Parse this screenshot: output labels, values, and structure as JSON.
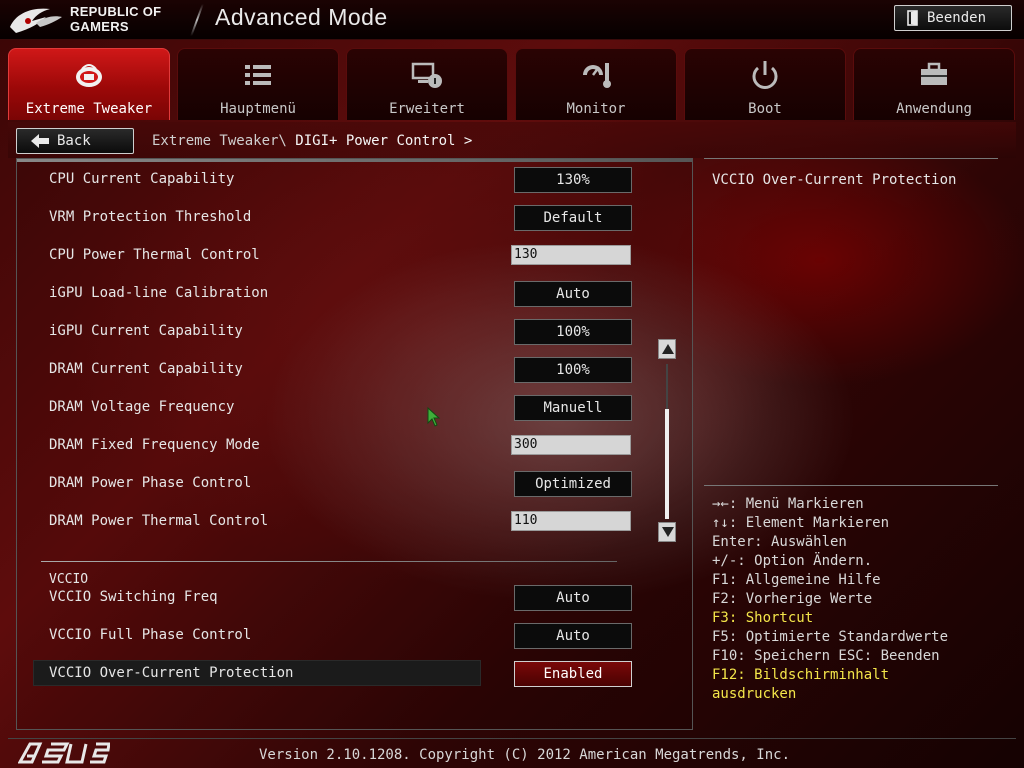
{
  "header": {
    "brand_line1": "REPUBLIC OF",
    "brand_line2": "GAMERS",
    "title": "Advanced Mode",
    "exit_label": "Beenden"
  },
  "tabs": [
    {
      "label": "Extreme Tweaker",
      "icon": "tweaker-icon",
      "active": true
    },
    {
      "label": "Hauptmenü",
      "icon": "list-icon",
      "active": false
    },
    {
      "label": "Erweitert",
      "icon": "advanced-icon",
      "active": false
    },
    {
      "label": "Monitor",
      "icon": "monitor-icon",
      "active": false
    },
    {
      "label": "Boot",
      "icon": "power-icon",
      "active": false
    },
    {
      "label": "Anwendung",
      "icon": "toolbox-icon",
      "active": false
    }
  ],
  "nav": {
    "back_label": "Back",
    "breadcrumb_path": "Extreme Tweaker\\",
    "breadcrumb_current": "DIGI+ Power Control >"
  },
  "settings": [
    {
      "label": "CPU Current Capability",
      "value": "130%",
      "kind": "select"
    },
    {
      "label": "VRM Protection Threshold",
      "value": "Default",
      "kind": "select"
    },
    {
      "label": "CPU Power Thermal Control",
      "value": "130",
      "kind": "input"
    },
    {
      "label": "iGPU Load-line Calibration",
      "value": "Auto",
      "kind": "select"
    },
    {
      "label": "iGPU Current Capability",
      "value": "100%",
      "kind": "select"
    },
    {
      "label": "DRAM Current Capability",
      "value": "100%",
      "kind": "select"
    },
    {
      "label": "DRAM Voltage Frequency",
      "value": "Manuell",
      "kind": "select"
    },
    {
      "label": "DRAM Fixed Frequency Mode",
      "value": "300",
      "kind": "input"
    },
    {
      "label": "DRAM Power Phase Control",
      "value": "Optimized",
      "kind": "select"
    },
    {
      "label": "DRAM Power Thermal Control",
      "value": "110",
      "kind": "input"
    }
  ],
  "vccio": {
    "section_title": "VCCIO",
    "items": [
      {
        "label": "VCCIO Switching Freq",
        "value": "Auto",
        "kind": "select"
      },
      {
        "label": "VCCIO Full Phase Control",
        "value": "Auto",
        "kind": "select"
      },
      {
        "label": "VCCIO Over-Current Protection",
        "value": "Enabled",
        "kind": "select",
        "selected": true
      }
    ]
  },
  "help": {
    "description": "VCCIO Over-Current Protection",
    "keys": [
      {
        "text": "→←: Menü Markieren",
        "highlight": false
      },
      {
        "text": "↑↓: Element Markieren",
        "highlight": false
      },
      {
        "text": "Enter: Auswählen",
        "highlight": false
      },
      {
        "text": "+/-: Option Ändern.",
        "highlight": false
      },
      {
        "text": "F1: Allgemeine Hilfe",
        "highlight": false
      },
      {
        "text": "F2: Vorherige Werte",
        "highlight": false
      },
      {
        "text": "F3: Shortcut",
        "highlight": true
      },
      {
        "text": "F5: Optimierte Standardwerte",
        "highlight": false
      },
      {
        "text": "F10: Speichern  ESC: Beenden",
        "highlight": false
      },
      {
        "text": "F12: Bildschirminhalt",
        "highlight": true
      },
      {
        "text": "ausdrucken",
        "highlight": true
      }
    ]
  },
  "footer": {
    "version": "Version 2.10.1208. Copyright (C) 2012 American Megatrends, Inc."
  },
  "colors": {
    "accent_red": "#c41010",
    "highlight_yellow": "#f4e64a"
  }
}
